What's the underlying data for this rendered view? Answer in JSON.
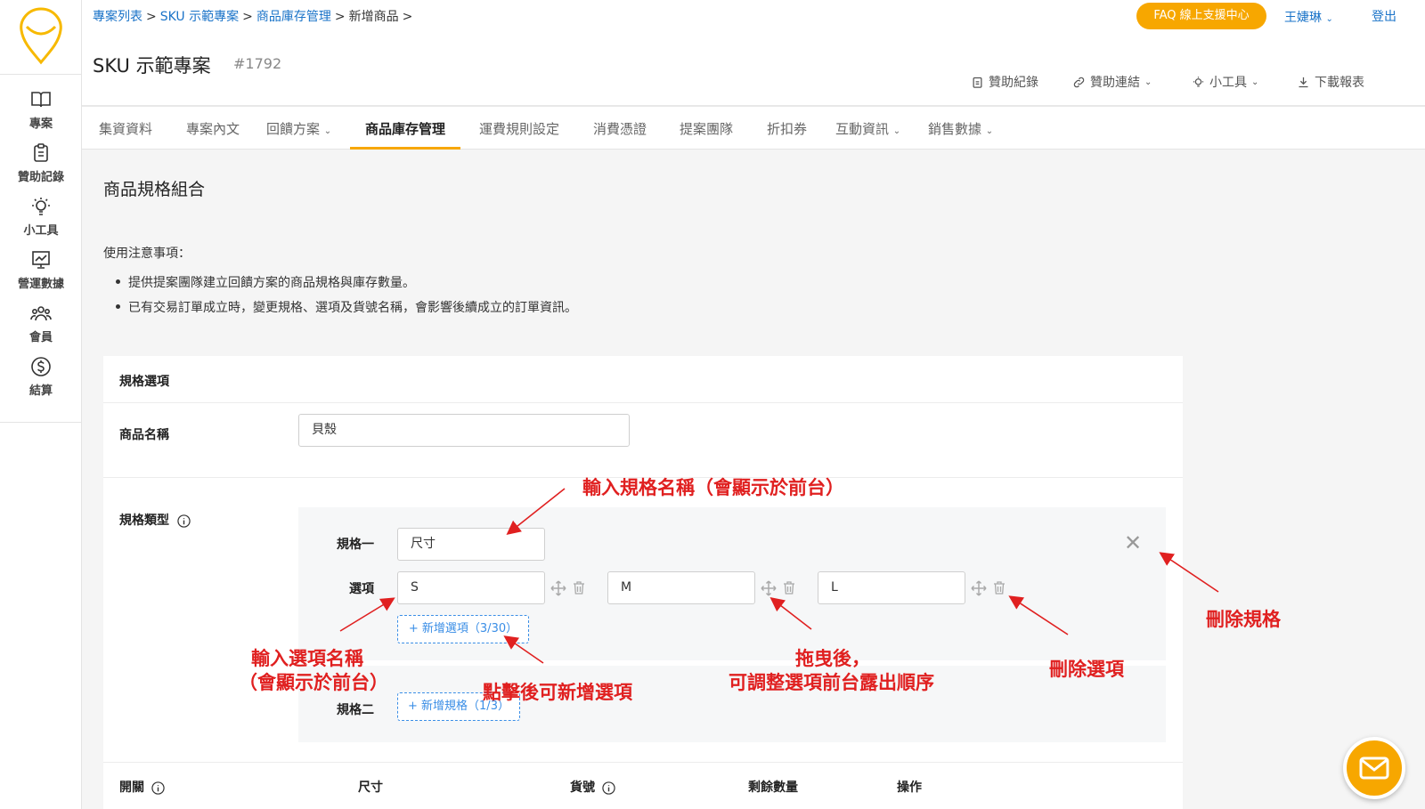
{
  "breadcrumb": [
    "專案列表",
    "SKU 示範專案",
    "商品庫存管理",
    "新增商品"
  ],
  "breadcrumb_sep": ">",
  "project": {
    "title": "SKU 示範專案",
    "id": "#1792"
  },
  "header": {
    "faq": "FAQ 線上支援中心",
    "user": "王婕琳",
    "logout": "登出",
    "tools": [
      "贊助紀錄",
      "贊助連結",
      "小工具",
      "下載報表"
    ]
  },
  "sidebar": {
    "items": [
      {
        "label": "專案",
        "icon": "book-icon"
      },
      {
        "label": "贊助記錄",
        "icon": "clipboard-icon"
      },
      {
        "label": "小工具",
        "icon": "lightbulb-icon"
      },
      {
        "label": "營運數據",
        "icon": "chart-board-icon"
      },
      {
        "label": "會員",
        "icon": "members-icon"
      },
      {
        "label": "結算",
        "icon": "dollar-icon"
      }
    ]
  },
  "tabs": [
    "集資資料",
    "專案內文",
    "回饋方案",
    "商品庫存管理",
    "運費規則設定",
    "消費憑證",
    "提案團隊",
    "折扣券",
    "互動資訊",
    "銷售數據"
  ],
  "active_tab": "商品庫存管理",
  "section_title": "商品規格組合",
  "notice": {
    "title": "使用注意事項：",
    "items": [
      "提供提案團隊建立回饋方案的商品規格與庫存數量。",
      "已有交易訂單成立時，變更規格、選項及貨號名稱，會影響後續成立的訂單資訊。"
    ]
  },
  "form": {
    "card_title": "規格選項",
    "product_name_label": "商品名稱",
    "product_name_value": "貝殼",
    "spec_type_label": "規格類型",
    "spec1_label": "規格一",
    "spec1_value": "尺寸",
    "options_label": "選項",
    "options": [
      "S",
      "M",
      "L"
    ],
    "add_option": "+ 新增選項（3/30）",
    "spec2_label": "規格二",
    "add_spec": "+ 新增規格（1/3）"
  },
  "table_headers": [
    "開關",
    "尺寸",
    "貨號",
    "剩餘數量",
    "操作"
  ],
  "annotations": {
    "spec_name": "輸入規格名稱（會顯示於前台）",
    "option_name_1": "輸入選項名稱",
    "option_name_2": "（會顯示於前台）",
    "add_option_hint": "點擊後可新增選項",
    "drag_1": "拖曳後，",
    "drag_2": "可調整選項前台露出順序",
    "delete_option": "刪除選項",
    "delete_spec": "刪除規格"
  },
  "colors": {
    "accent": "#f7a700",
    "link": "#1a73c8",
    "annotation": "#e02020"
  }
}
